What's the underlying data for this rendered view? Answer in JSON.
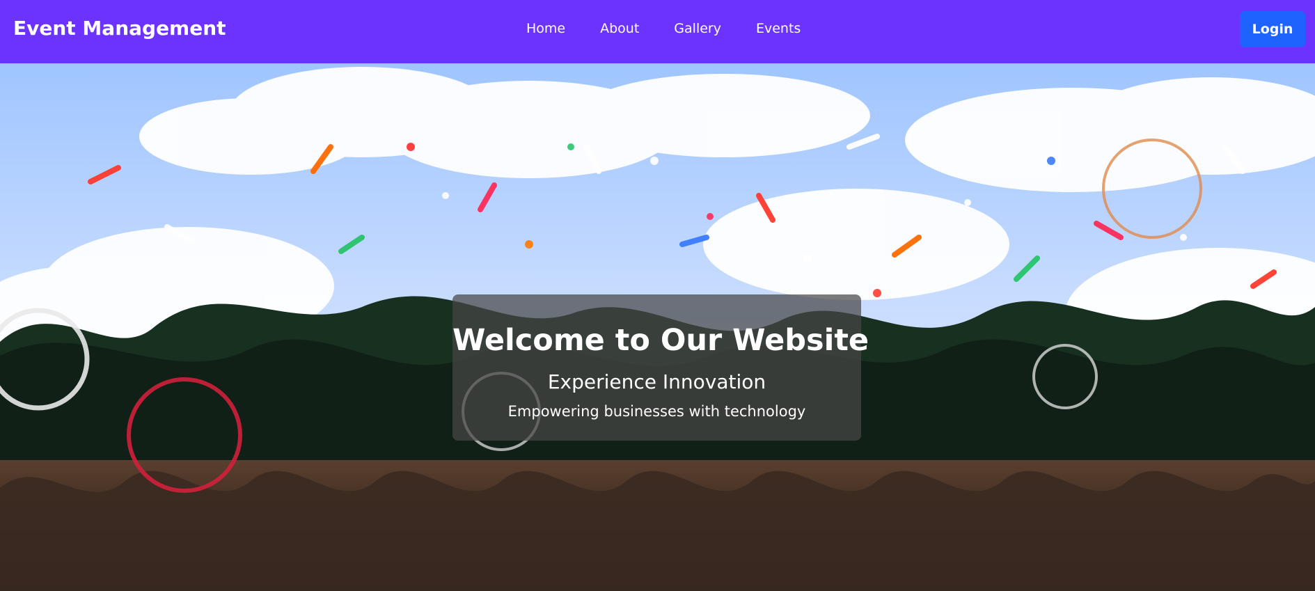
{
  "navbar": {
    "brand": "Event Management",
    "links": [
      {
        "label": "Home"
      },
      {
        "label": "About"
      },
      {
        "label": "Gallery"
      },
      {
        "label": "Events"
      }
    ],
    "login_label": "Login"
  },
  "hero": {
    "title": "Welcome to Our Website",
    "subtitle": "Experience Innovation",
    "description": "Empowering businesses with technology"
  },
  "colors": {
    "navbar_bg": "#6c33ff",
    "login_bg": "#1f63ff",
    "text": "#ffffff"
  }
}
